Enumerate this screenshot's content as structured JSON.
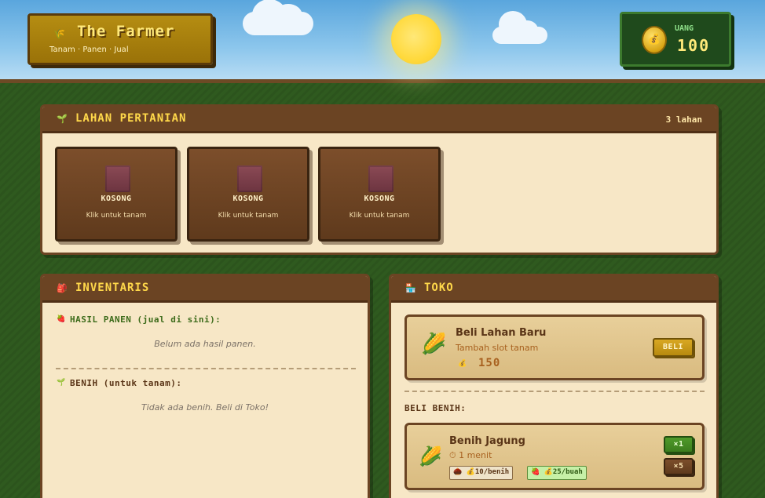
{
  "header": {
    "title": "The Farmer",
    "subtitle": "Tanam · Panen · Jual",
    "title_icon": "🌾",
    "money_label": "UANG",
    "money_value": "100",
    "money_icon": "💰"
  },
  "colors": {
    "sky": "#8cc6ec",
    "grass": "#2f5a1f",
    "panel_bg": "#f7e7c6",
    "panel_head": "#6b4423",
    "accent_gold": "#ffd84a",
    "money_green": "#1f4a1c"
  },
  "lahan": {
    "title": "LAHAN PERTANIAN",
    "icon": "🌱",
    "count": "3 lahan",
    "plots": [
      {
        "status": "KOSONG",
        "hint": "Klik untuk tanam"
      },
      {
        "status": "KOSONG",
        "hint": "Klik untuk tanam"
      },
      {
        "status": "KOSONG",
        "hint": "Klik untuk tanam"
      }
    ]
  },
  "inventaris": {
    "title": "INVENTARIS",
    "icon": "🎒",
    "harvest_label": "HASIL PANEN (jual di sini):",
    "harvest_icon": "🍓",
    "harvest_empty": "Belum ada hasil panen.",
    "seeds_label": "BENIH (untuk tanam):",
    "seeds_icon": "🌱",
    "seeds_empty": "Tidak ada benih. Beli di Toko!"
  },
  "toko": {
    "title": "TOKO",
    "icon": "🏪",
    "land_item": {
      "icon": "🌽",
      "title": "Beli Lahan Baru",
      "subtitle": "Tambah slot tanam",
      "price_icon": "💰",
      "price": "150",
      "buy_label": "BELI"
    },
    "seeds_section_label": "BELI BENIH:",
    "seed_items": [
      {
        "icon": "🌽",
        "name": "Benih Jagung",
        "time": "⏱ 1 menit",
        "cost_tag": "💰10/benih",
        "cost_icon": "🌰",
        "sell_tag": "💰25/buah",
        "sell_icon": "🍓",
        "buy_one": "×1",
        "buy_five": "×5"
      }
    ]
  }
}
